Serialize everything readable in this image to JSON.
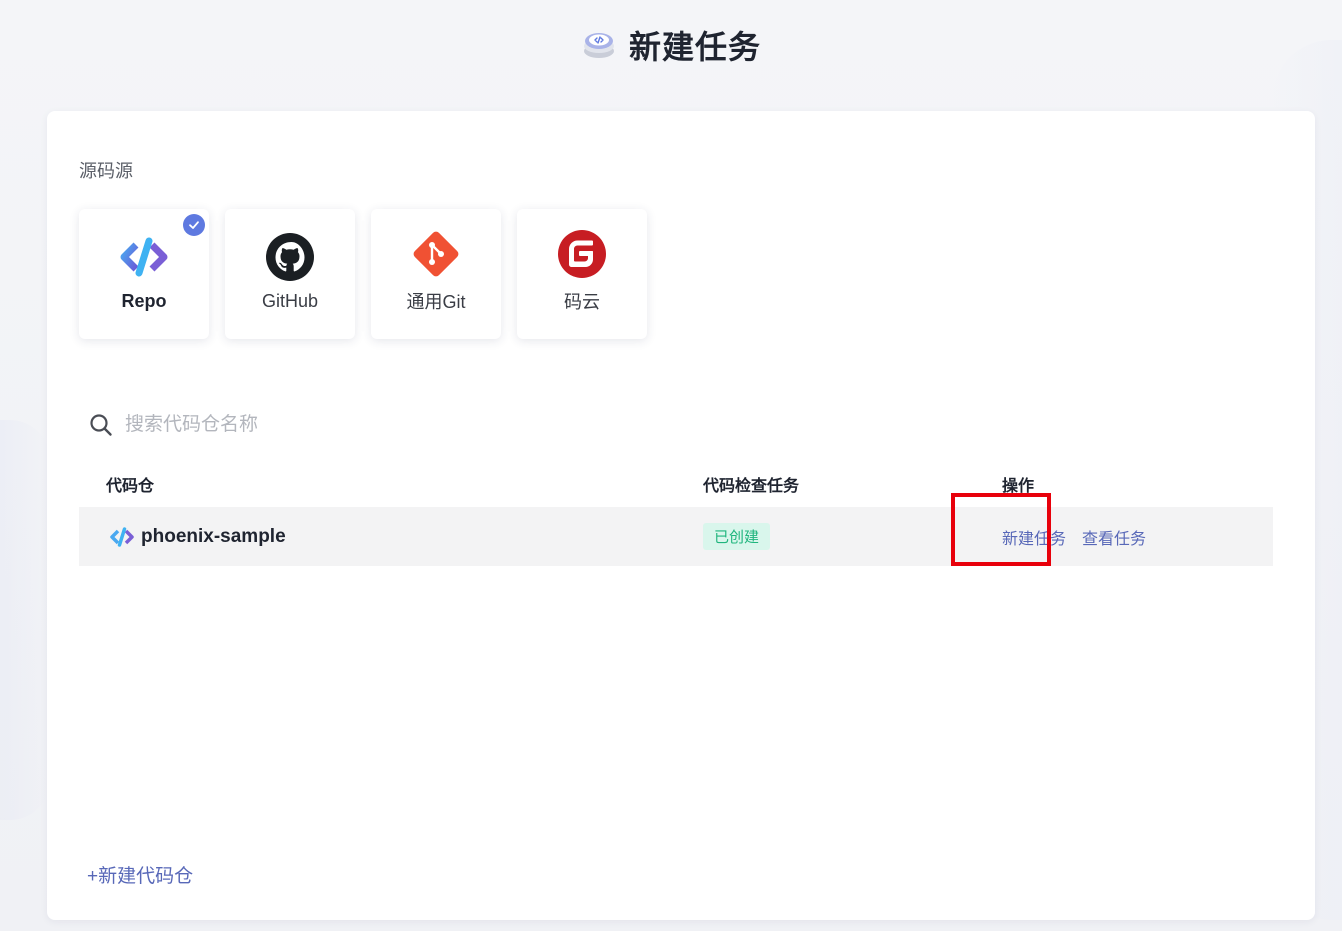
{
  "header": {
    "title": "新建任务",
    "logo_icon": "code-disc-icon"
  },
  "source_section": {
    "label": "源码源",
    "items": [
      {
        "label": "Repo",
        "icon": "repo-icon",
        "selected": true
      },
      {
        "label": "GitHub",
        "icon": "github-icon",
        "selected": false
      },
      {
        "label": "通用Git",
        "icon": "git-icon",
        "selected": false
      },
      {
        "label": "码云",
        "icon": "gitee-icon",
        "selected": false
      }
    ]
  },
  "search": {
    "placeholder": "搜索代码仓名称",
    "value": ""
  },
  "table": {
    "columns": [
      "代码仓",
      "代码检查任务",
      "操作"
    ],
    "rows": [
      {
        "repo": "phoenix-sample",
        "status": "已创建",
        "actions": [
          "新建任务",
          "查看任务"
        ]
      }
    ]
  },
  "footer": {
    "add_repo_label": "+新建代码仓"
  },
  "colors": {
    "accent": "#5868b8",
    "check": "#5e79e0",
    "status_bg": "#d9f6ec",
    "status_text": "#1fb57d",
    "highlight": "#e8000b"
  }
}
